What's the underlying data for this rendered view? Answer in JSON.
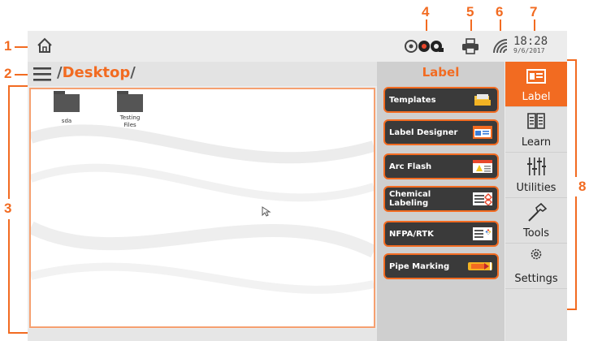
{
  "callouts": [
    "1",
    "2",
    "3",
    "4",
    "5",
    "6",
    "7",
    "8"
  ],
  "topbar": {
    "time": "18:28",
    "date": "9/6/2017",
    "icons": [
      "home-icon",
      "status-icons",
      "printer-icon",
      "wifi-icon"
    ]
  },
  "path": {
    "slash_open": "/",
    "folder": "Desktop",
    "slash_close": "/"
  },
  "desktop": {
    "items": [
      {
        "label": "sda"
      },
      {
        "label_line1": "Testing",
        "label_line2": "Files"
      }
    ]
  },
  "label_panel": {
    "heading": "Label",
    "buttons": [
      {
        "label": "Templates",
        "icon": "templates-icon"
      },
      {
        "label": "Label Designer",
        "icon": "label-designer-icon"
      },
      {
        "label": "Arc Flash",
        "icon": "arc-flash-icon"
      },
      {
        "label_line1": "Chemical",
        "label_line2": "Labeling",
        "icon": "chemical-labeling-icon"
      },
      {
        "label": "NFPA/RTK",
        "icon": "nfpa-icon"
      },
      {
        "label": "Pipe Marking",
        "icon": "pipe-marking-icon"
      }
    ]
  },
  "nav": {
    "items": [
      {
        "label": "Label",
        "active": true
      },
      {
        "label": "Learn"
      },
      {
        "label": "Utilities"
      },
      {
        "label": "Tools"
      },
      {
        "label": "Settings"
      }
    ]
  },
  "colors": {
    "accent": "#f26b21",
    "button": "#3a3a3a"
  }
}
